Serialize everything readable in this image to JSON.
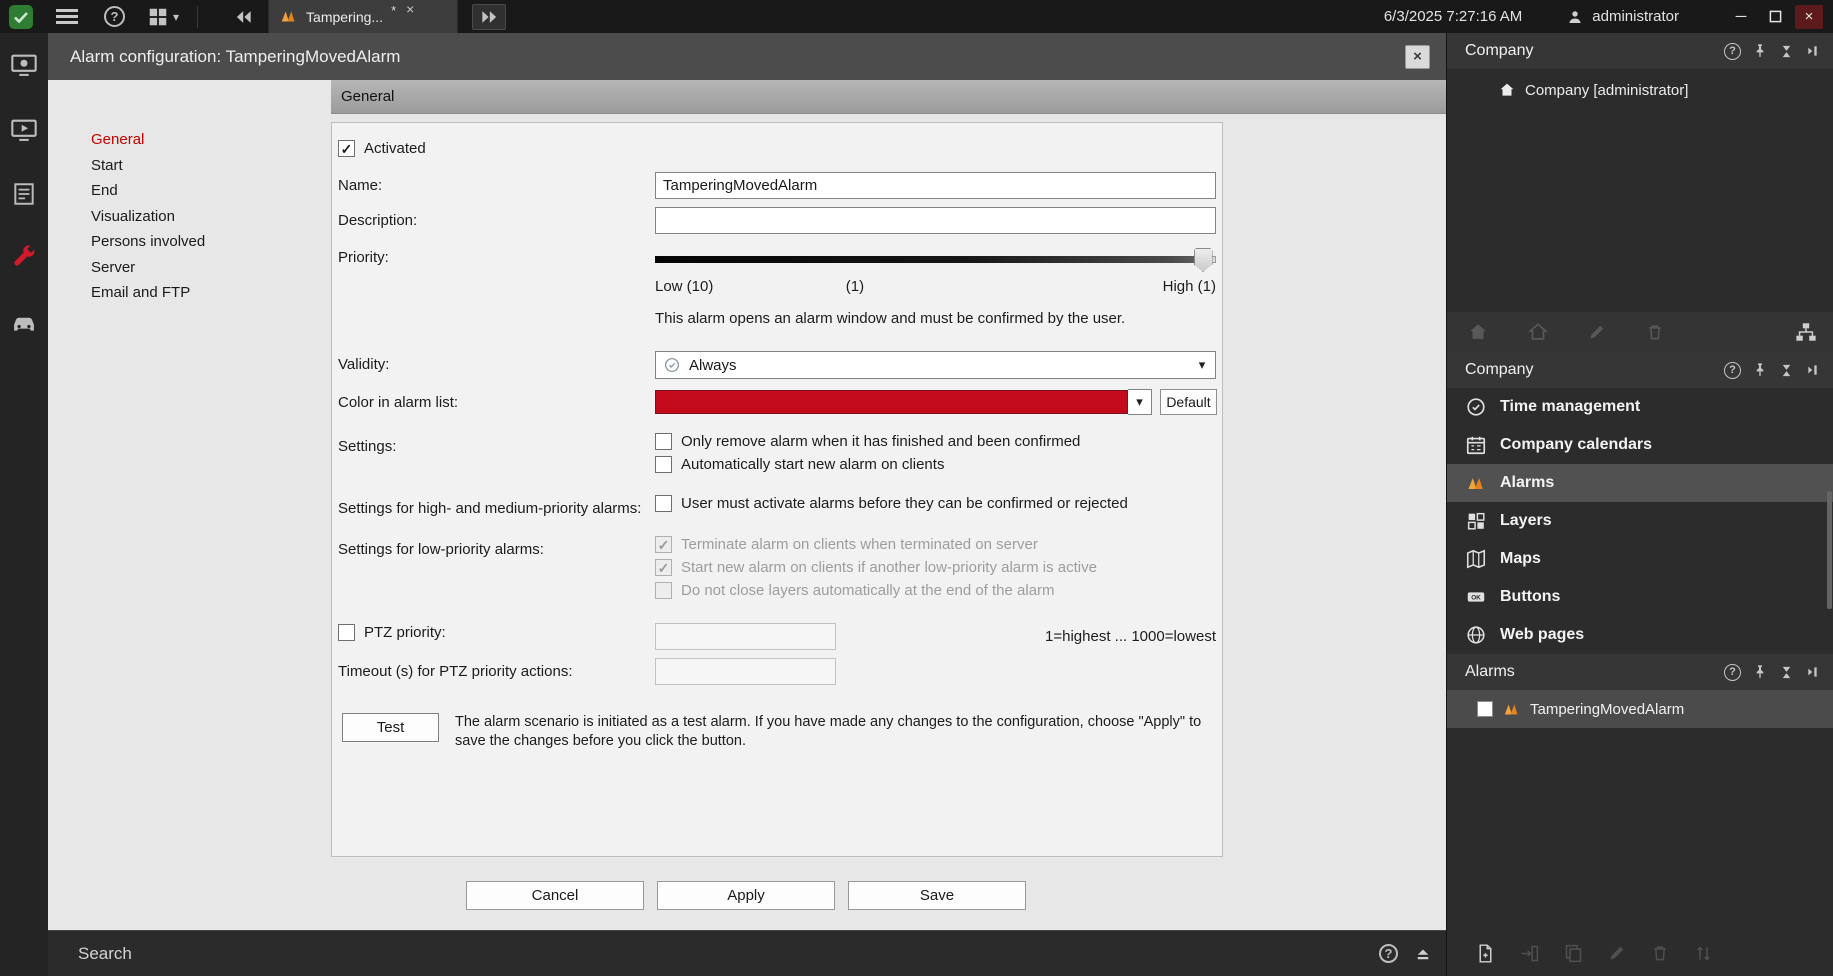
{
  "icons": {
    "close": "×",
    "caret_down": "▾",
    "modified": "*",
    "minimize": "─",
    "help": "?"
  },
  "colors": {
    "accent_red": "#d31a2b",
    "alarm_list_color": "#c30b1c",
    "nav_active_red": "#c40000"
  },
  "topbar": {
    "tab_label": "Tampering...",
    "clock": "6/3/2025 7:27:16 AM",
    "user": "administrator"
  },
  "dialog": {
    "title": "Alarm configuration: TamperingMovedAlarm",
    "section": "General",
    "nav": [
      "General",
      "Start",
      "End",
      "Visualization",
      "Persons involved",
      "Server",
      "Email and FTP"
    ],
    "form": {
      "activated": "Activated",
      "name_label": "Name:",
      "name_value": "TamperingMovedAlarm",
      "description_label": "Description:",
      "description_value": "",
      "priority_label": "Priority:",
      "priority_low": "Low (10)",
      "priority_current": "(1)",
      "priority_high": "High (1)",
      "priority_note": "This alarm opens an alarm window and must be confirmed by the user.",
      "validity_label": "Validity:",
      "validity_value": "Always",
      "color_label": "Color in alarm list:",
      "color_value": "#c30b1c",
      "default_button": "Default",
      "settings_label": "Settings:",
      "settings_option1": "Only remove alarm when it has finished and been confirmed",
      "settings_option2": "Automatically start new alarm on clients",
      "high_label": "Settings for high- and medium-priority alarms:",
      "high_option": "User must activate alarms before they can be confirmed or rejected",
      "low_label": "Settings for low-priority alarms:",
      "low_option1": "Terminate alarm on clients when terminated on server",
      "low_option2": "Start new alarm on clients if another low-priority alarm is active",
      "low_option3": "Do not close layers automatically at the end of the alarm",
      "ptz_label": "PTZ priority:",
      "ptz_hint": "1=highest ... 1000=lowest",
      "timeout_label": "Timeout (s) for PTZ priority actions:",
      "test_button": "Test",
      "test_note": "The alarm scenario is initiated as a test alarm. If you have made any changes to the configuration, choose \"Apply\" to save the changes before you click the button."
    },
    "buttons": {
      "cancel": "Cancel",
      "apply": "Apply",
      "save": "Save"
    }
  },
  "sidebar": {
    "tree_title": "Company",
    "tree_item": "Company [administrator]",
    "nav_title": "Company",
    "nav_items": [
      "Time management",
      "Company calendars",
      "Alarms",
      "Layers",
      "Maps",
      "Buttons",
      "Web pages"
    ],
    "alarms_title": "Alarms",
    "alarm_item": "TamperingMovedAlarm"
  },
  "statusbar": {
    "search": "Search"
  }
}
